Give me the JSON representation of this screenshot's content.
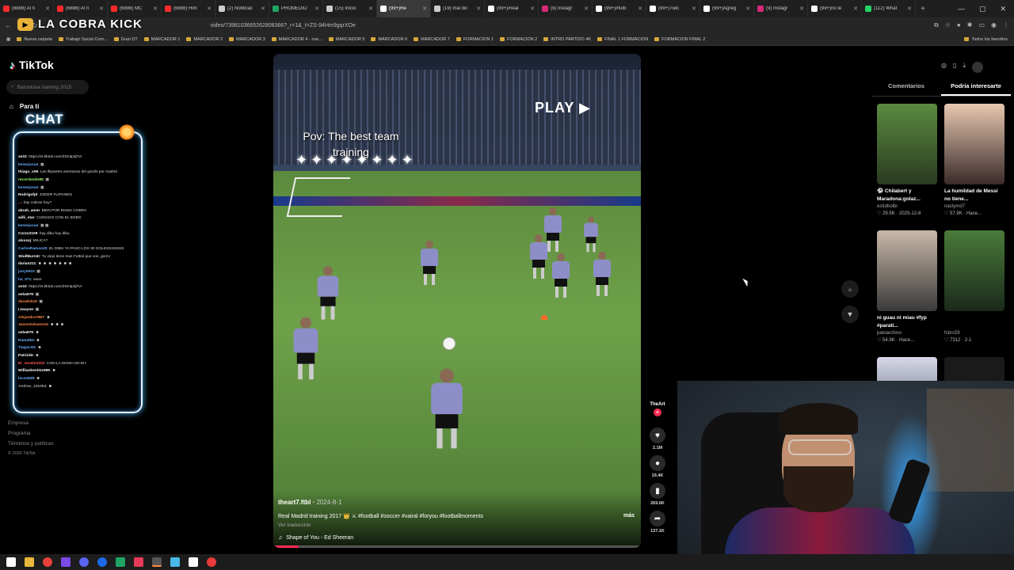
{
  "tabs": [
    {
      "title": "(8898) AI fi",
      "color": "#ff2a2a"
    },
    {
      "title": "(6898) AI fi",
      "color": "#ff2a2a"
    },
    {
      "title": "(6898) MC",
      "color": "#ff2a2a"
    },
    {
      "title": "(6898) Him",
      "color": "#ff2a2a"
    },
    {
      "title": "(2) Notificac",
      "color": "#cccccc"
    },
    {
      "title": "PROMEDIO",
      "color": "#1fa463"
    },
    {
      "title": "(15) Inicio",
      "color": "#cccccc"
    },
    {
      "title": "(99+)Re",
      "color": "#ffffff",
      "active": true
    },
    {
      "title": "(19) mal dic",
      "color": "#cccccc"
    },
    {
      "title": "(99+)#real",
      "color": "#ffffff"
    },
    {
      "title": "(9) Instagr",
      "color": "#d62976"
    },
    {
      "title": "(99+)#futb",
      "color": "#ffffff"
    },
    {
      "title": "(99+)Twic",
      "color": "#ffffff"
    },
    {
      "title": "(99+)Agreg",
      "color": "#ffffff"
    },
    {
      "title": "(9) Instagr",
      "color": "#d62976"
    },
    {
      "title": "(99+)no le",
      "color": "#ffffff"
    },
    {
      "title": "(112) What",
      "color": "#25d366"
    }
  ],
  "url": "video/7398103665262808366?_r=1&_t=ZS-94Hm9gqrXOe",
  "bookmarks": [
    "Nueva carpeta",
    "Trabajo Social Com...",
    "Gran DT",
    "MARCADOR 1",
    "MARCADOR 2",
    "MARCADOR 3",
    "MARCADOR 4 - ove...",
    "MARCADOR 5",
    "MARCADOR 6",
    "MARCADOR 7",
    "FORMACION 1",
    "FORMACION 2",
    "INTRO PARTIDO 4K",
    "FINAL 1 FORMACION",
    "FORMACION FINAL 2"
  ],
  "bookmarks_all": "Todos los favoritos",
  "overlay": {
    "channel": "LA COBRA KICK",
    "chat_title": "CHAT"
  },
  "tiktok": {
    "logo": "TikTok",
    "search_placeholder": "Barcelona training 2015",
    "nav_fyp": "Para ti",
    "footer": [
      "Empresa",
      "Programa",
      "Términos y políticas"
    ],
    "copyright": "© 2026 TikTok"
  },
  "chat": [
    {
      "user": "xe10",
      "msg": ": https://vt.tiktok.com/ZSmtpdjTv/",
      "color": "#ffffff"
    },
    {
      "user": "kenerjosue",
      "msg": ": ▦",
      "color": "#6ab0ff"
    },
    {
      "user": "thiago_x08",
      "msg": ": Las Illipantes aventuras del gordin por madrid",
      "color": "#ffffff"
    },
    {
      "user": "recordando95",
      "msg": ": ▦",
      "color": "#9aff6a"
    },
    {
      "user": "kenerjosue",
      "msg": ": ▦",
      "color": "#6ab0ff"
    },
    {
      "user": "Rodrigofpl",
      "msg": ": JODER FLIPANDO",
      "color": "#ffffff"
    },
    {
      "user": "...",
      "msg": ": hay cobran hoy?",
      "color": "#ff5a5a"
    },
    {
      "user": "abrah_amm",
      "msg": ": BIEN POR MAMA COBRA",
      "color": "#ffffff"
    },
    {
      "user": "willi_star",
      "msg": ": CUIDADO CON EL BOBO",
      "color": "#ffffff"
    },
    {
      "user": "kenerjosue",
      "msg": ": ▦ ▦",
      "color": "#6ab0ff"
    },
    {
      "user": "Corzo2109",
      "msg": ": hay dibu hay dibu",
      "color": "#ffffff"
    },
    {
      "user": "alxxssj",
      "msg": ": MILICA?",
      "color": "#ffffff"
    },
    {
      "user": "CarlosRamos20",
      "msg": ": EL DIBU YA PASO LOS 30 GOLESSSSSSS",
      "color": "#6ab0ff"
    },
    {
      "user": "SkullBurn3r",
      "msg": ": Tu viejo tiene mas Futbol que vos, gorzo",
      "color": "#ffffff"
    },
    {
      "user": "darian211",
      "msg": ": ☻ ☻ ☻ ☻ ☻ ☻ ☻",
      "color": "#ffffff"
    },
    {
      "user": "jony0910",
      "msg": ": ▦",
      "color": "#6ab0ff"
    },
    {
      "user": "lui_071",
      "msg": ": eeee",
      "color": "#6ab0ff"
    },
    {
      "user": "xe10",
      "msg": ": https://vt.tiktok.com/ZSmtpdjTv/",
      "color": "#ffffff"
    },
    {
      "user": "seba979",
      "msg": ": ▦",
      "color": "#ffffff"
    },
    {
      "user": "davafob19",
      "msg": ": ▦",
      "color": "#ff8a4a"
    },
    {
      "user": "Liwayne",
      "msg": ": ▦",
      "color": "#ffffff"
    },
    {
      "user": "Alejandro7867",
      "msg": ": ☻",
      "color": "#ff8a4a"
    },
    {
      "user": "JasonSalsano24",
      "msg": ": ☻ ☻ ☻",
      "color": "#ff8a4a"
    },
    {
      "user": "seba979",
      "msg": ": ☻",
      "color": "#ffffff"
    },
    {
      "user": "Ramal84",
      "msg": ": ☻",
      "color": "#6ab0ff"
    },
    {
      "user": "TiagoLH1",
      "msg": ": ☻",
      "color": "#6ab0ff"
    },
    {
      "user": "Patrick5",
      "msg": ": ☻",
      "color": "#ffffff"
    },
    {
      "user": "El_Jonelo3332",
      "msg": ": CON LA MAMA NO EH",
      "color": "#ff5a5a"
    },
    {
      "user": "Willianbenitez999",
      "msg": ": ☻",
      "color": "#ffffff"
    },
    {
      "user": "lecas838",
      "msg": ": ☻",
      "color": "#6ab0ff"
    },
    {
      "user": "Andres_231004",
      "msg": ": ☻",
      "color": "#aaaaaa"
    }
  ],
  "video": {
    "badge": "PLAY ▶",
    "caption": "Pov: The best team training",
    "author": "theart7.ftbl",
    "date": "2024-8-1",
    "description": "Real Madrid training 2017 👑 ⚔ #football #soccer #vairal #foryou #footballmoments",
    "more": "más",
    "translate": "Ver traducción",
    "music": "Shape of You - Ed Sheeran",
    "progress": 0.07
  },
  "actions": {
    "creator": "TheArt",
    "likes": "2.1M",
    "comments": "19.4K",
    "saves": "269.6K",
    "shares": "137.1K"
  },
  "right_panel": {
    "tabs": [
      "Comentarios",
      "Podría interesarte"
    ],
    "cards": [
      {
        "title": "⚽ Chilabert y Maradona:golaz...",
        "author": "esfutbolbr",
        "meta": "♡ 29.5K · 2025-12-8",
        "thumb": [
          "#5a8a3e",
          "#2a3a22"
        ]
      },
      {
        "title": "La humildad de Messi no tiene...",
        "author": "nastymd7",
        "meta": "♡ 57.9K · Hace...",
        "thumb": [
          "#e8c8b0",
          "#3a2a2a"
        ]
      },
      {
        "title": "ni guau ni miau #fyp #parati...",
        "author": "patoarchivo",
        "meta": "♡ 54.9K · Hace...",
        "thumb": [
          "#c8b8a8",
          "#3a3a3a"
        ]
      },
      {
        "title": "",
        "author": "fcbrc59",
        "meta": "♡ 7312 · 2-1",
        "thumb": [
          "#4a7a3a",
          "#1a2a1a"
        ]
      },
      {
        "title": "",
        "author": "",
        "meta": "",
        "thumb": [
          "#d8d8e8",
          "#3a4a5a"
        ]
      },
      {
        "title": "",
        "author": "",
        "meta": "",
        "thumb": [
          "#1a1a1a",
          "#1a1a1a"
        ]
      }
    ]
  }
}
